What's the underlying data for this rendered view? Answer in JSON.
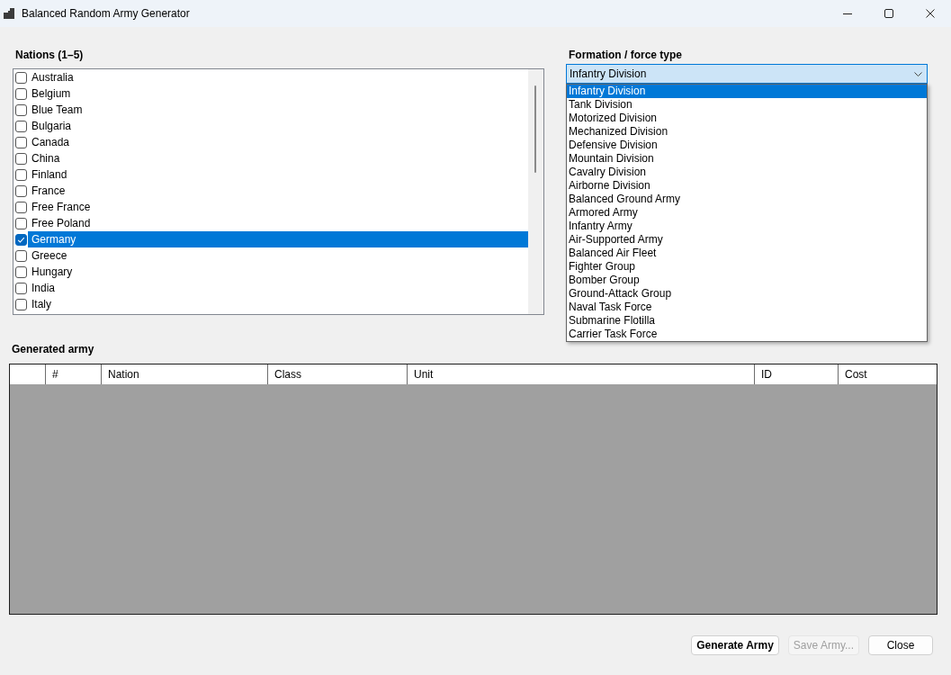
{
  "window": {
    "title": "Balanced Random Army Generator"
  },
  "nations": {
    "label": "Nations (1–5)",
    "items": [
      {
        "label": "Australia",
        "checked": false,
        "selected": false
      },
      {
        "label": "Belgium",
        "checked": false,
        "selected": false
      },
      {
        "label": "Blue Team",
        "checked": false,
        "selected": false
      },
      {
        "label": "Bulgaria",
        "checked": false,
        "selected": false
      },
      {
        "label": "Canada",
        "checked": false,
        "selected": false
      },
      {
        "label": "China",
        "checked": false,
        "selected": false
      },
      {
        "label": "Finland",
        "checked": false,
        "selected": false
      },
      {
        "label": "France",
        "checked": false,
        "selected": false
      },
      {
        "label": "Free France",
        "checked": false,
        "selected": false
      },
      {
        "label": "Free Poland",
        "checked": false,
        "selected": false
      },
      {
        "label": "Germany",
        "checked": true,
        "selected": true
      },
      {
        "label": "Greece",
        "checked": false,
        "selected": false
      },
      {
        "label": "Hungary",
        "checked": false,
        "selected": false
      },
      {
        "label": "India",
        "checked": false,
        "selected": false
      },
      {
        "label": "Italy",
        "checked": false,
        "selected": false
      }
    ]
  },
  "formation": {
    "label": "Formation / force type",
    "value": "Infantry Division",
    "expanded": true,
    "options": [
      {
        "label": "Infantry Division",
        "selected": true
      },
      {
        "label": "Tank Division",
        "selected": false
      },
      {
        "label": "Motorized Division",
        "selected": false
      },
      {
        "label": "Mechanized Division",
        "selected": false
      },
      {
        "label": "Defensive Division",
        "selected": false
      },
      {
        "label": "Mountain Division",
        "selected": false
      },
      {
        "label": "Cavalry Division",
        "selected": false
      },
      {
        "label": "Airborne Division",
        "selected": false
      },
      {
        "label": "Balanced Ground Army",
        "selected": false
      },
      {
        "label": "Armored Army",
        "selected": false
      },
      {
        "label": "Infantry Army",
        "selected": false
      },
      {
        "label": "Air-Supported Army",
        "selected": false
      },
      {
        "label": "Balanced Air Fleet",
        "selected": false
      },
      {
        "label": "Fighter Group",
        "selected": false
      },
      {
        "label": "Bomber Group",
        "selected": false
      },
      {
        "label": "Ground-Attack Group",
        "selected": false
      },
      {
        "label": "Naval Task Force",
        "selected": false
      },
      {
        "label": "Submarine Flotilla",
        "selected": false
      },
      {
        "label": "Carrier Task Force",
        "selected": false
      }
    ]
  },
  "army": {
    "label": "Generated army",
    "columns": [
      "#",
      "Nation",
      "Class",
      "Unit",
      "ID",
      "Cost"
    ]
  },
  "buttons": [
    {
      "label": "Generate Army",
      "kind": "default",
      "disabled": false
    },
    {
      "label": "Save Army...",
      "kind": "normal",
      "disabled": true
    },
    {
      "label": "Close",
      "kind": "normal",
      "disabled": false
    }
  ]
}
